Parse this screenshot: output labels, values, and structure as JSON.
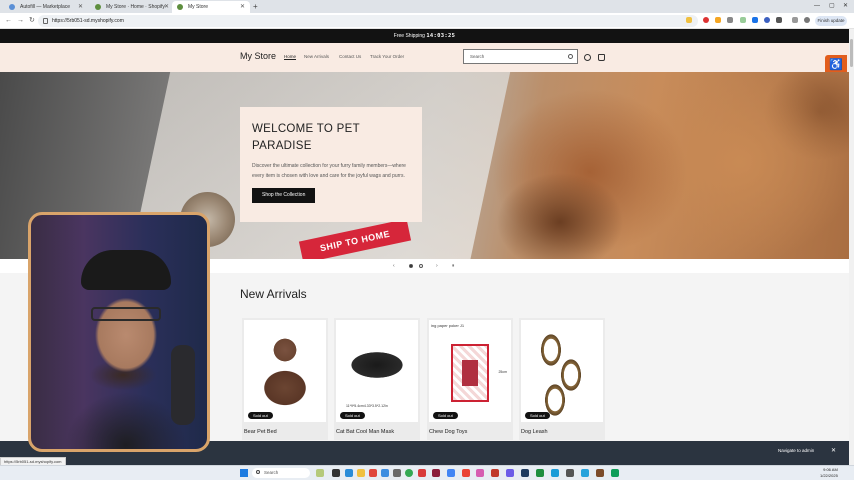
{
  "browser": {
    "tabs": [
      {
        "title": "Autofill — Marketplace",
        "active": false
      },
      {
        "title": "My Store · Home · Shopify",
        "active": false
      },
      {
        "title": "My Store",
        "active": true
      }
    ],
    "url": "https://5rb051-sd.myshopify.com",
    "finish_update": "Finish update",
    "status_url": "https://5rb051-sd.myshopify.com"
  },
  "announcement": {
    "label": "Free Shipping",
    "countdown": "14:03:25"
  },
  "header": {
    "logo": "My Store",
    "nav": [
      "Home",
      "New Arrivals",
      "Contact Us",
      "Track Your Order"
    ],
    "active_nav": "Home",
    "search_placeholder": "Search"
  },
  "hero": {
    "title": "WELCOME TO PET PARADISE",
    "text": "Discover the ultimate collection for your furry family members—where every item is chosen with love and care for the joyful wags and purrs.",
    "button": "Shop the Collection",
    "image_text_ribbon": "SHIP TO HOME",
    "slides_total": 2,
    "current_slide": 1
  },
  "arrivals": {
    "title": "New Arrivals",
    "products": [
      {
        "name": "Bear Pet Bed",
        "badge": "Sold out"
      },
      {
        "name": "Cat Bat Cool Man Mask",
        "badge": "Sold out",
        "image_caption": "11*9*5.4cm4.33*3.5*2.12in"
      },
      {
        "name": "Chew Dog Toys",
        "badge": "Sold out",
        "image_caption": "ing paper poker J1",
        "image_measure": "25cm"
      },
      {
        "name": "Dog Leash",
        "badge": "Sold out"
      }
    ]
  },
  "admin_bar": {
    "navigate": "Navigate to admin"
  },
  "taskbar": {
    "search": "Search",
    "time": "9:06 AM",
    "date": "1/22/2025"
  },
  "colors": {
    "header_bg": "#f9ebe3",
    "announcement_bg": "#121212",
    "accessibility": "#e25d1c",
    "webcam_border": "#d9a46a"
  }
}
